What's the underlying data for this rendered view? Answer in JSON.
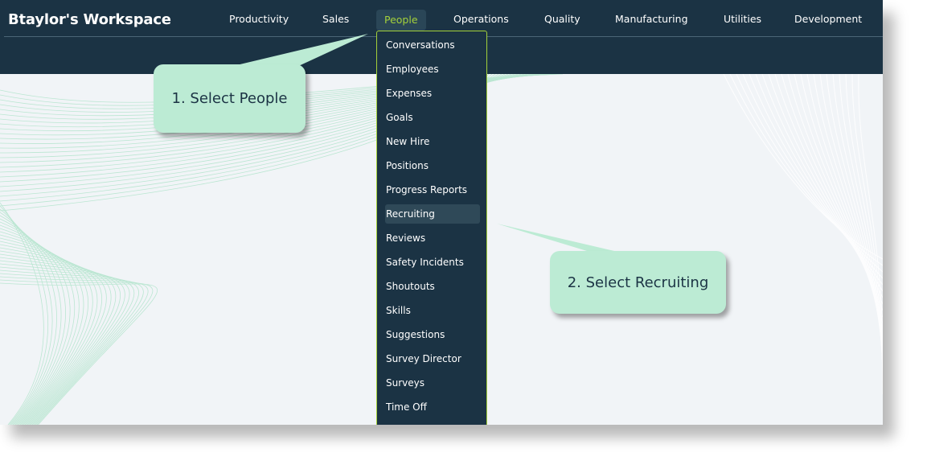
{
  "header": {
    "brand": "Btaylor's Workspace",
    "nav": [
      {
        "label": "Productivity"
      },
      {
        "label": "Sales"
      },
      {
        "label": "People"
      },
      {
        "label": "Operations"
      },
      {
        "label": "Quality"
      },
      {
        "label": "Manufacturing"
      },
      {
        "label": "Utilities"
      },
      {
        "label": "Development"
      }
    ],
    "active_nav": "People"
  },
  "people_menu": {
    "items": [
      {
        "label": "Conversations"
      },
      {
        "label": "Employees"
      },
      {
        "label": "Expenses"
      },
      {
        "label": "Goals"
      },
      {
        "label": "New Hire"
      },
      {
        "label": "Positions"
      },
      {
        "label": "Progress Reports"
      },
      {
        "label": "Recruiting"
      },
      {
        "label": "Reviews"
      },
      {
        "label": "Safety Incidents"
      },
      {
        "label": "Shoutouts"
      },
      {
        "label": "Skills"
      },
      {
        "label": "Suggestions"
      },
      {
        "label": "Survey Director"
      },
      {
        "label": "Surveys"
      },
      {
        "label": "Time Off"
      }
    ],
    "highlighted": "Recruiting"
  },
  "callouts": {
    "step1": "1. Select People",
    "step2": "2. Select Recruiting"
  },
  "colors": {
    "header_bg": "#1b3344",
    "accent": "#a4d13a",
    "callout_bg": "#bcebd4",
    "content_bg": "#f1f4f7"
  }
}
